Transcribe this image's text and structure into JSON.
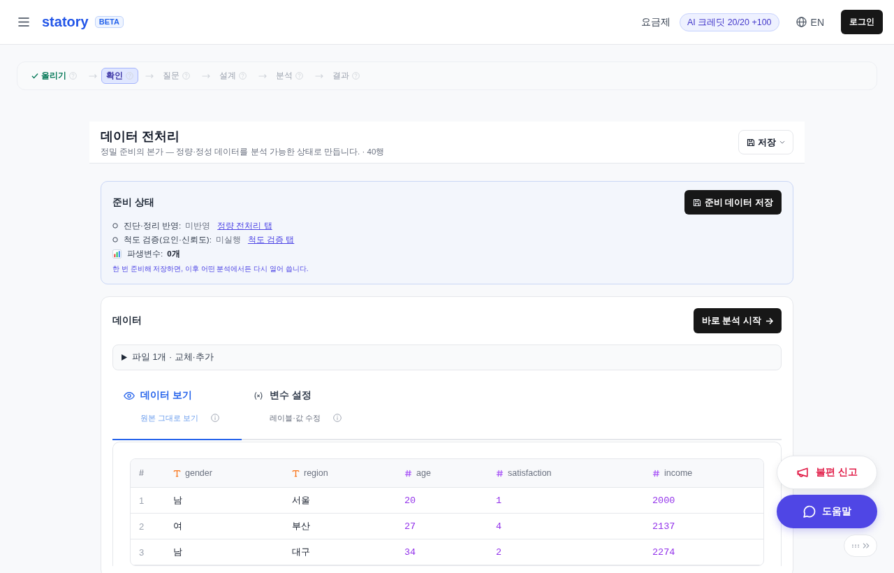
{
  "header": {
    "logo": "statory",
    "badge": "BETA",
    "pricing": "요금제",
    "credits": "AI 크레딧 20/20 +100",
    "language": "EN",
    "login": "로그인"
  },
  "steps": [
    {
      "label": "올리기",
      "done": true,
      "selected": false
    },
    {
      "label": "확인",
      "done": false,
      "selected": true
    },
    {
      "label": "질문",
      "done": false,
      "selected": false
    },
    {
      "label": "설계",
      "done": false,
      "selected": false
    },
    {
      "label": "분석",
      "done": false,
      "selected": false
    },
    {
      "label": "결과",
      "done": false,
      "selected": false
    }
  ],
  "page": {
    "title": "데이터 전처리",
    "subtitle": "정밀 준비의 본가 — 정량·정성 데이터를 분석 가능한 상태로 만듭니다. · 40행",
    "save_button": "저장"
  },
  "prep": {
    "title": "준비 상태",
    "button": "준비 데이터 저장",
    "items": [
      {
        "kind": "status",
        "done": false,
        "label": "진단·정리 반영:",
        "value": "미반영",
        "link": "정량 전처리 탭"
      },
      {
        "kind": "status",
        "done": false,
        "label": "척도 검증(요인·신뢰도):",
        "value": "미실행",
        "link": "척도 검증 탭"
      },
      {
        "kind": "count",
        "label": "파생변수:",
        "value": "0개"
      }
    ],
    "note": "한 번 준비해 저장하면, 이후 어떤 분석에서든 다시 열어 씁니다."
  },
  "data": {
    "title": "데이터",
    "start_button": "바로 분석 시작",
    "files": {
      "label": "파일 1개 · 교체·추가",
      "expanded": false
    },
    "tabs": [
      {
        "kind": "view",
        "label": "데이터 보기",
        "hint": "원본 그대로 보기",
        "selected": true
      },
      {
        "kind": "variables",
        "label": "변수 설정",
        "hint": "레이블·값 수정",
        "selected": false
      }
    ],
    "table": {
      "columns": [
        {
          "label": "#",
          "kind": "index"
        },
        {
          "label": "gender",
          "kind": "text"
        },
        {
          "label": "region",
          "kind": "text"
        },
        {
          "label": "age",
          "kind": "number"
        },
        {
          "label": "satisfaction",
          "kind": "number"
        },
        {
          "label": "income",
          "kind": "number"
        }
      ],
      "rows": [
        [
          "1",
          "남",
          "서울",
          "20",
          "1",
          "2000"
        ],
        [
          "2",
          "여",
          "부산",
          "27",
          "4",
          "2137"
        ],
        [
          "3",
          "남",
          "대구",
          "34",
          "2",
          "2274"
        ]
      ]
    }
  },
  "floating": {
    "report": "불편 신고",
    "help": "도움말"
  }
}
